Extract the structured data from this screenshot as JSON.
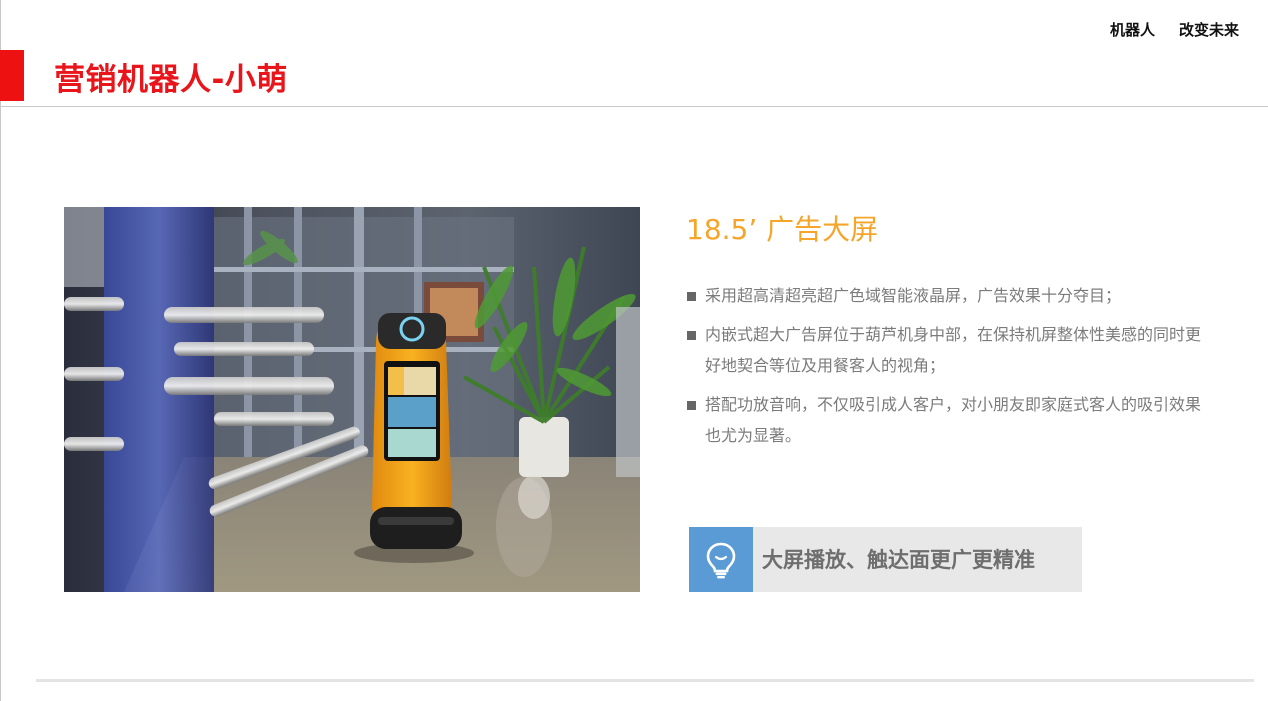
{
  "header": {
    "title": "营销机器人-小萌",
    "links": [
      "机器人",
      "改变未来"
    ]
  },
  "feature": {
    "title": "18.5’ 广告大屏",
    "bullets": [
      "采用超高清超亮超广色域智能液晶屏，广告效果十分夺目；",
      "内嵌式超大广告屏位于葫芦机身中部，在保持机屏整体性美感的同时更好地契合等位及用餐客人的视角；",
      "搭配功放音响，不仅吸引成人客户，对小朋友即家庭式客人的吸引效果也尤为显著。"
    ]
  },
  "callout": {
    "text": "大屏播放、触达面更广更精准",
    "icon": "lightbulb-icon"
  },
  "photo": {
    "description_icon": "robot-photo"
  },
  "colors": {
    "brand_red": "#e8151b",
    "accent_orange": "#f5a62a",
    "icon_blue": "#5b9bd5"
  }
}
